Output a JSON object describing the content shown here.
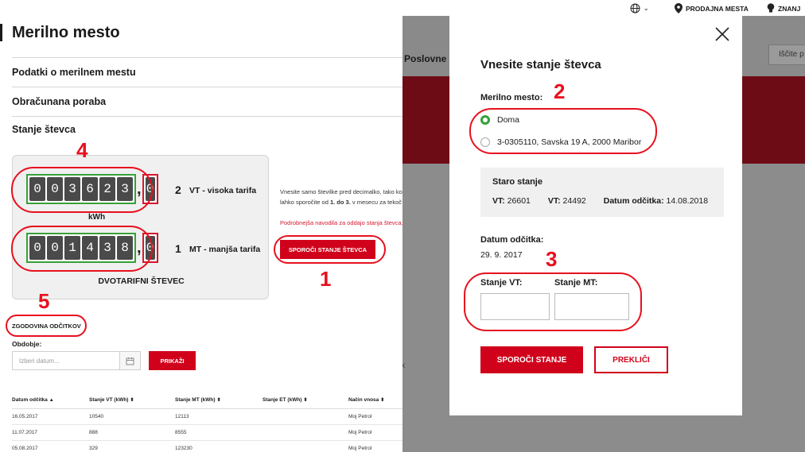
{
  "left": {
    "page_title": "Merilno mesto",
    "sections": [
      "Podatki o merilnem mestu",
      "Obračunana poraba",
      "Stanje števca"
    ],
    "meter": {
      "vt_digits": [
        "0",
        "0",
        "3",
        "6",
        "2",
        "3"
      ],
      "vt_decimal": "0",
      "vt_number": "2",
      "vt_label": "VT - visoka tarifa",
      "unit": "kWh",
      "mt_digits": [
        "0",
        "0",
        "1",
        "4",
        "3",
        "8"
      ],
      "mt_decimal": "0",
      "mt_number": "1",
      "mt_label": "MT - manjša tarifa",
      "caption": "DVOTARIFNI ŠTEVEC"
    },
    "hint_line1": "Vnesite samo številke pred decimalko, tako ko",
    "hint_line2_a": "lahko sporočite od ",
    "hint_line2_b": "1. do 3.",
    "hint_line2_c": " v mesecu za tekoč",
    "hint_link": "Podrobnejša navodila za oddajo stanja števca.",
    "report_button": "SPOROČI STANJE ŠTEVCA",
    "history_title": "ZGODOVINA ODČITKOV",
    "period_label": "Obdobje:",
    "date_placeholder": "Izberi datum...",
    "show_button": "PRIKAŽI",
    "table": {
      "headers": [
        "Datum odčitka",
        "Stanje VT (kWh)",
        "Stanje MT (kWh)",
        "Stanje ET (kWh)",
        "Način vnosa"
      ],
      "rows": [
        [
          "16.05.2017",
          "10540",
          "12113",
          "",
          "Moj Petrol"
        ],
        [
          "11.07.2017",
          "888",
          "8555",
          "",
          "Moj Petrol"
        ],
        [
          "05.08.2017",
          "329",
          "123230",
          "",
          "Moj Petrol"
        ]
      ]
    }
  },
  "right_bg": {
    "topbar_shop": "PRODAJNA MESTA",
    "topbar_more": "ZNANJ",
    "nav_text": "Poslovne",
    "search_text": "Iščite p",
    "stray_k": "k"
  },
  "modal": {
    "title": "Vnesite stanje števca",
    "meter_label": "Merilno mesto:",
    "options": [
      "Doma",
      "3-0305110, Savska 19 A, 2000 Maribor"
    ],
    "selected_index": 0,
    "prev_title": "Staro stanje",
    "prev_vt_label": "VT:",
    "prev_vt_value": "26601",
    "prev_mt_label": "VT:",
    "prev_mt_value": "24492",
    "prev_date_label": "Datum odčitka:",
    "prev_date_value": "14.08.2018",
    "date_label": "Datum odčitka:",
    "date_value": "29. 9. 2017",
    "vt_input_label": "Stanje VT:",
    "mt_input_label": "Stanje MT:",
    "submit_button": "SPOROČI STANJE",
    "cancel_button": "PREKLIČI"
  },
  "annotations": [
    "1",
    "2",
    "3",
    "4",
    "5"
  ],
  "colors": {
    "brand_red": "#d0021b",
    "annotation_red": "#e8101e",
    "selected_green": "#37a03a"
  }
}
